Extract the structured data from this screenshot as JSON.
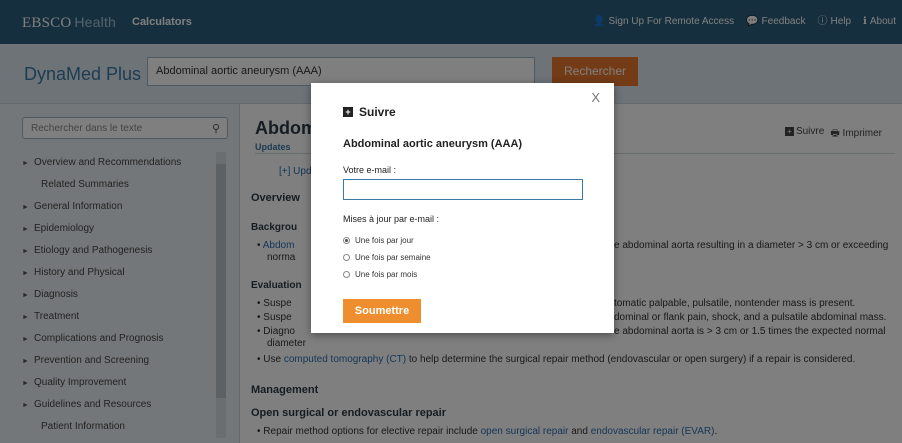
{
  "header": {
    "brand_main": "EBSCO",
    "brand_sub": "Health",
    "calculators": "Calculators",
    "nav": [
      {
        "icon": "user-icon",
        "label": "Sign Up For Remote Access"
      },
      {
        "icon": "comment-icon",
        "label": "Feedback"
      },
      {
        "icon": "help-icon",
        "label": "Help"
      },
      {
        "icon": "info-icon",
        "label": "About"
      }
    ]
  },
  "search": {
    "product": "DynaMed Plus",
    "query": "Abdominal aortic aneurysm (AAA)",
    "button": "Rechercher"
  },
  "sidebar": {
    "search_placeholder": "Rechercher dans le texte",
    "items": [
      {
        "label": "Overview and Recommendations",
        "sub": false
      },
      {
        "label": "Related Summaries",
        "sub": true
      },
      {
        "label": "General Information",
        "sub": false
      },
      {
        "label": "Epidemiology",
        "sub": false
      },
      {
        "label": "Etiology and Pathogenesis",
        "sub": false
      },
      {
        "label": "History and Physical",
        "sub": false
      },
      {
        "label": "Diagnosis",
        "sub": false
      },
      {
        "label": "Treatment",
        "sub": false
      },
      {
        "label": "Complications and Prognosis",
        "sub": false
      },
      {
        "label": "Prevention and Screening",
        "sub": false
      },
      {
        "label": "Quality Improvement",
        "sub": false
      },
      {
        "label": "Guidelines and Resources",
        "sub": false
      },
      {
        "label": "Patient Information",
        "sub": true
      }
    ]
  },
  "content": {
    "title": "Abdom",
    "updates": "Updates",
    "follow": "Suivre",
    "print": "Imprimer",
    "upd_line": "[+] Upd",
    "overview": "Overview",
    "background": "Backgrou",
    "bullet1a": "Abdom",
    "bullet1b": "norma",
    "bullet1_right": "e abdominal aorta resulting in a diameter > 3 cm or exceeding",
    "evaluation": "Evaluation",
    "e1a": "Suspe",
    "e1_right": "tomatic palpable, pulsatile, nontender mass is present.",
    "e2a": "Suspe",
    "e2_right": "dominal or flank pain, shock, and a pulsatile abdominal mass.",
    "e3a": "Diagno",
    "e3b": "diameter",
    "e3_right": "e abdominal aorta is > 3 cm or 1.5 times the expected normal",
    "e4_prefix": "Use ",
    "e4_link": "computed tomography (CT)",
    "e4_suffix": " to help determine the surgical repair method (endovascular or open surgery) if a repair is considered.",
    "management": "Management",
    "open_repair": "Open surgical or endovascular repair",
    "r1_prefix": "Repair method options for elective repair include ",
    "r1_link1": "open surgical repair",
    "r1_mid": " and ",
    "r1_link2": "endovascular repair (EVAR)",
    "r1_suffix": "."
  },
  "modal": {
    "close": "X",
    "title": "Suivre",
    "topic": "Abdominal aortic aneurysm (AAA)",
    "email_label": "Votre e-mail :",
    "email_value": "",
    "updates_label": "Mises à jour par e-mail :",
    "options": [
      {
        "label": "Une fois par jour",
        "selected": true
      },
      {
        "label": "Une fois par semaine",
        "selected": false
      },
      {
        "label": "Une fois par mois",
        "selected": false
      }
    ],
    "submit": "Soumettre"
  },
  "colors": {
    "header": "#2c5f7c",
    "accent": "#e6762c",
    "link": "#2a6fb0"
  }
}
